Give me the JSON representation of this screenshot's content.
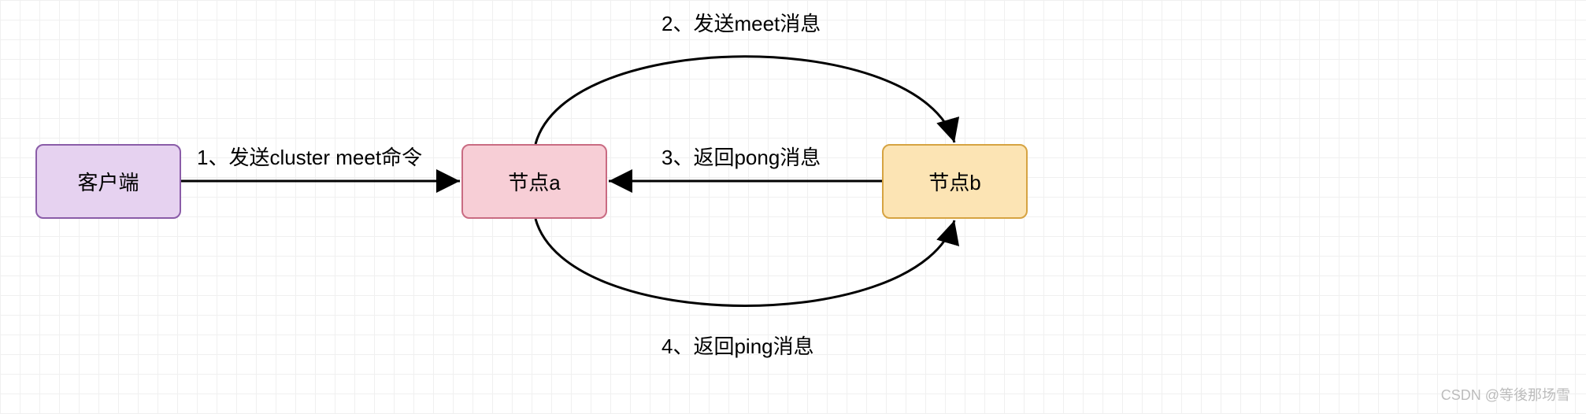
{
  "nodes": {
    "client": "客户端",
    "a": "节点a",
    "b": "节点b"
  },
  "edges": {
    "e1": "1、发送cluster meet命令",
    "e2": "2、发送meet消息",
    "e3": "3、返回pong消息",
    "e4": "4、返回ping消息"
  },
  "watermark": "CSDN @等後那场雪"
}
